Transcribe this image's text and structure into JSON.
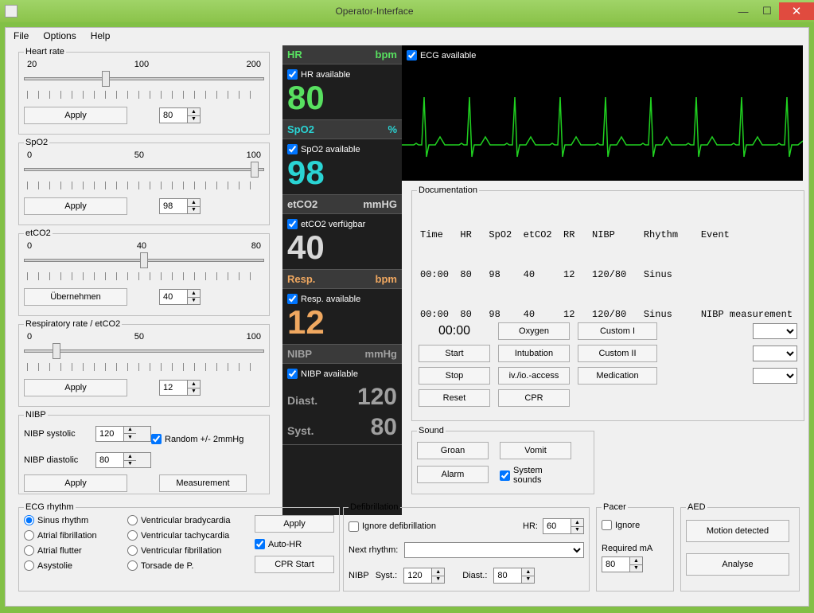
{
  "window": {
    "title": "Operator-Interface"
  },
  "menu": {
    "file": "File",
    "options": "Options",
    "help": "Help"
  },
  "hr": {
    "legend": "Heart rate",
    "ticks": [
      "20",
      "100",
      "200"
    ],
    "apply": "Apply",
    "value": "80"
  },
  "spo2": {
    "legend": "SpO2",
    "ticks": [
      "0",
      "50",
      "100"
    ],
    "apply": "Apply",
    "value": "98"
  },
  "etco2": {
    "legend": "etCO2",
    "ticks": [
      "0",
      "40",
      "80"
    ],
    "apply": "Übernehmen",
    "value": "40"
  },
  "rr": {
    "legend": "Respiratory rate / etCO2",
    "ticks": [
      "0",
      "50",
      "100"
    ],
    "apply": "Apply",
    "value": "12"
  },
  "nibp": {
    "legend": "NIBP",
    "sys_label": "NIBP systolic",
    "sys_value": "120",
    "dia_label": "NIBP diastolic",
    "dia_value": "80",
    "random": "Random +/- 2mmHg",
    "apply": "Apply",
    "measure": "Measurement"
  },
  "monitor": {
    "hr": {
      "name": "HR",
      "unit": "bpm",
      "available": "HR available",
      "value": "80"
    },
    "spo2": {
      "name": "SpO2",
      "unit": "%",
      "available": "SpO2 available",
      "value": "98"
    },
    "etco2": {
      "name": "etCO2",
      "unit": "mmHG",
      "available": "etCO2 verfügbar",
      "value": "40"
    },
    "resp": {
      "name": "Resp.",
      "unit": "bpm",
      "available": "Resp. available",
      "value": "12"
    },
    "nibp": {
      "name": "NIBP",
      "unit": "mmHg",
      "available": "NIBP available",
      "diast_label": "Diast.",
      "diast_value": "120",
      "syst_label": "Syst.",
      "syst_value": "80"
    }
  },
  "ecg": {
    "available": "ECG available"
  },
  "doc": {
    "legend": "Documentation",
    "header": "Time   HR   SpO2  etCO2  RR   NIBP     Rhythm    Event",
    "row1": "00:00  80   98    40     12   120/80   Sinus",
    "row2": "00:00  80   98    40     12   120/80   Sinus     NIBP measurement",
    "timer": "00:00",
    "btns": {
      "start": "Start",
      "stop": "Stop",
      "reset": "Reset",
      "oxygen": "Oxygen",
      "intubation": "Intubation",
      "iv": "iv./io.-access",
      "cpr": "CPR",
      "c1": "Custom I",
      "c2": "Custom II",
      "med": "Medication"
    }
  },
  "sound": {
    "legend": "Sound",
    "groan": "Groan",
    "vomit": "Vomit",
    "alarm": "Alarm",
    "sys": "System sounds"
  },
  "ecgr": {
    "legend": "ECG rhythm",
    "r": [
      "Sinus rhythm",
      "Atrial fibrillation",
      "Atrial flutter",
      "Asystolie",
      "Ventricular bradycardia",
      "Ventricular tachycardia",
      "Ventricular fibrillation",
      "Torsade de P."
    ],
    "apply": "Apply",
    "auto": "Auto-HR",
    "cpr": "CPR Start"
  },
  "defib": {
    "legend": "Defibrillation",
    "ignore": "Ignore defibrillation",
    "hr": "HR:",
    "hr_val": "60",
    "next": "Next rhythm:",
    "nibp": "NIBP",
    "syst": "Syst.:",
    "syst_val": "120",
    "diast": "Diast.:",
    "diast_val": "80"
  },
  "pacer": {
    "legend": "Pacer",
    "ignore": "Ignore",
    "req": "Required mA",
    "val": "80"
  },
  "aed": {
    "legend": "AED",
    "motion": "Motion detected",
    "analyse": "Analyse"
  }
}
